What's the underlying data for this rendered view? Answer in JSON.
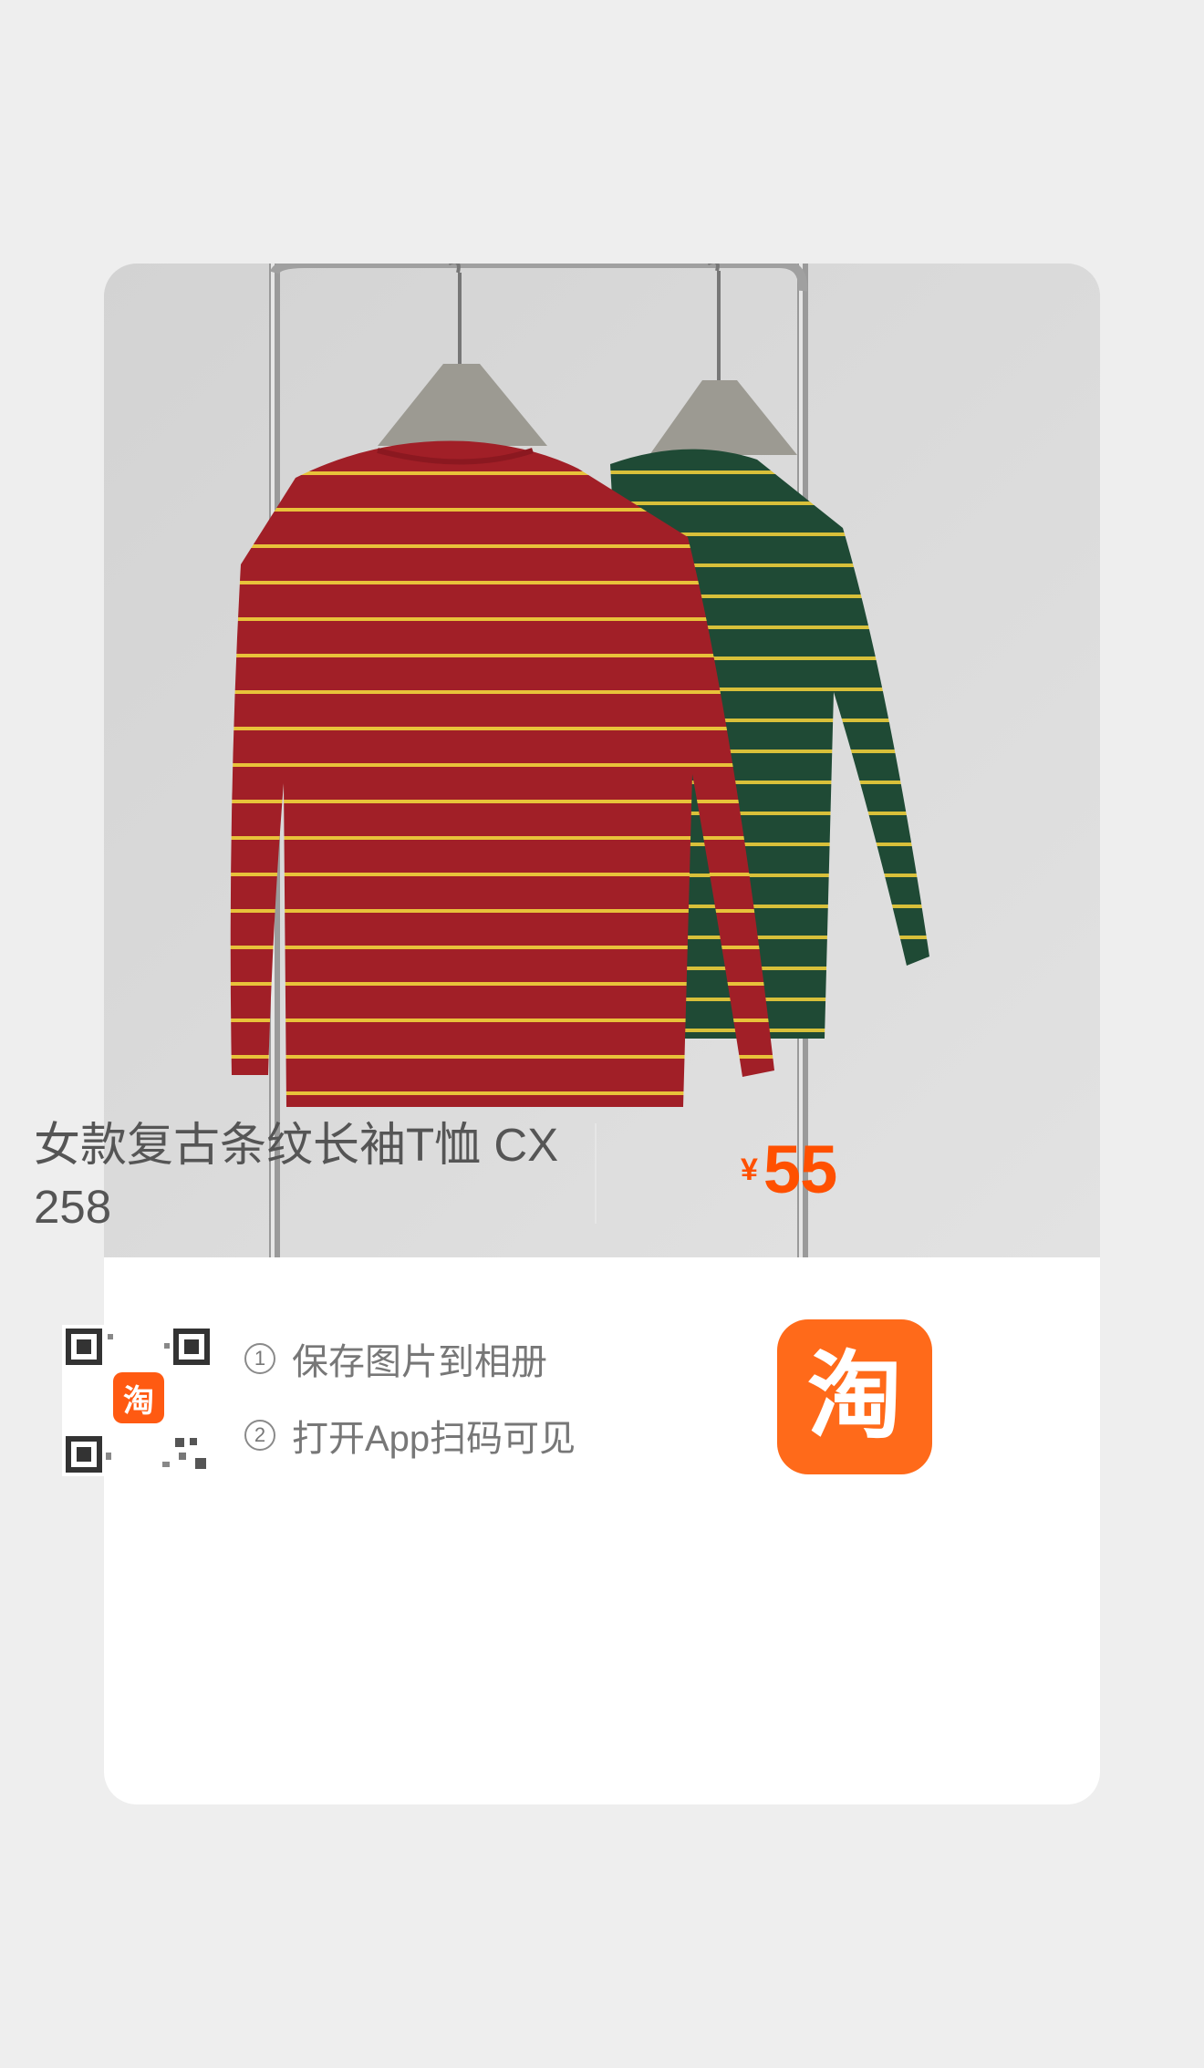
{
  "product": {
    "title": "女款复古条纹长袖T恤 CX258",
    "currency": "¥",
    "price": "55"
  },
  "share": {
    "qr_badge": "淘",
    "steps": [
      {
        "num": "1",
        "text": "保存图片到相册"
      },
      {
        "num": "2",
        "text": "打开App扫码可见"
      }
    ],
    "app_logo": "淘"
  },
  "colors": {
    "accent": "#ff5000",
    "logo": "#ff6a1a",
    "shirt_red": "#a11f27",
    "shirt_green": "#1f4a35",
    "stripe": "#e8c23a"
  },
  "icons": [
    "qr-code-icon",
    "taobao-logo-icon"
  ]
}
